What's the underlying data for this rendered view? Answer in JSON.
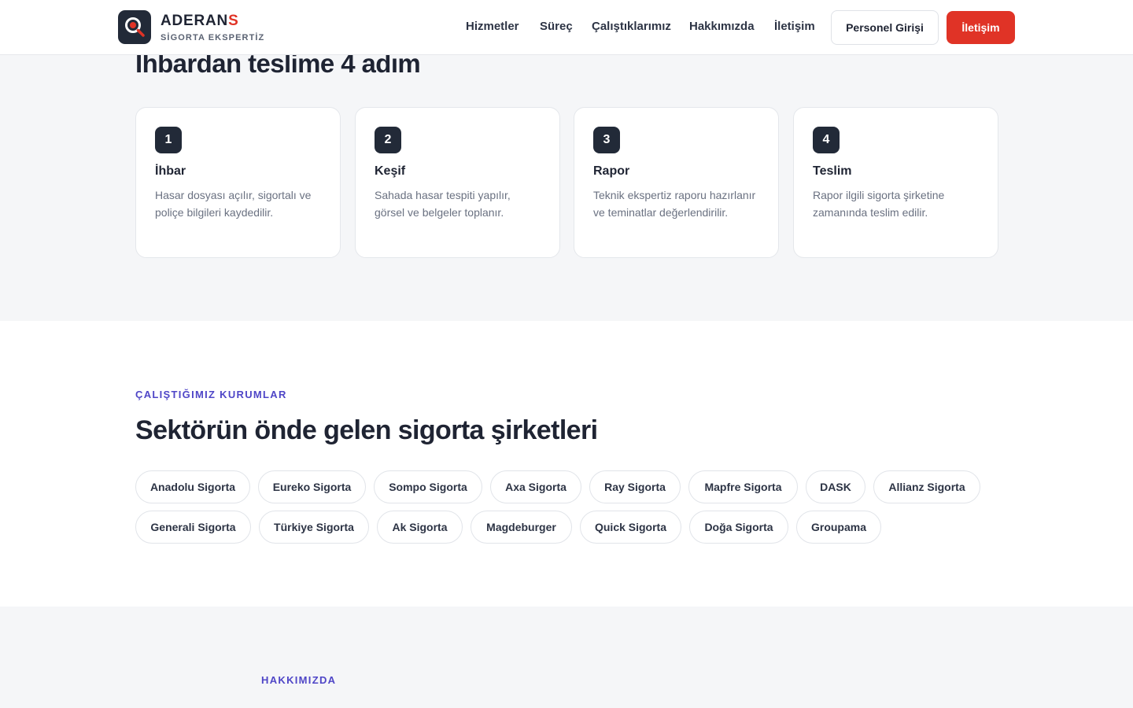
{
  "brand": {
    "name_main": "ADERAN",
    "name_accent": "S",
    "tagline": "SİGORTA EKSPERTİZ",
    "accent_color": "#e03326",
    "dark_color": "#222a38"
  },
  "nav": {
    "links": [
      "Hizmetler",
      "Süreç",
      "Çalıştıklarımız",
      "Hakkımızda",
      "İletişim"
    ],
    "login_label": "Personel Girişi",
    "cta_label": "İletişim"
  },
  "process": {
    "title": "İhbardan teslime 4 adım",
    "steps": [
      {
        "num": "1",
        "title": "İhbar",
        "desc": "Hasar dosyası açılır, sigortalı ve poliçe bilgileri kaydedilir."
      },
      {
        "num": "2",
        "title": "Keşif",
        "desc": "Sahada hasar tespiti yapılır, görsel ve belgeler toplanır."
      },
      {
        "num": "3",
        "title": "Rapor",
        "desc": "Teknik ekspertiz raporu hazırlanır ve teminatlar değerlendirilir."
      },
      {
        "num": "4",
        "title": "Teslim",
        "desc": "Rapor ilgili sigorta şirketine zamanında teslim edilir."
      }
    ]
  },
  "partners": {
    "eyebrow": "ÇALIŞTIĞIMIZ KURUMLAR",
    "title": "Sektörün önde gelen sigorta şirketleri",
    "companies": [
      "Anadolu Sigorta",
      "Eureko Sigorta",
      "Sompo Sigorta",
      "Axa Sigorta",
      "Ray Sigorta",
      "Mapfre Sigorta",
      "DASK",
      "Allianz Sigorta",
      "Generali Sigorta",
      "Türkiye Sigorta",
      "Ak Sigorta",
      "Magdeburger",
      "Quick Sigorta",
      "Doğa Sigorta",
      "Groupama"
    ]
  },
  "about": {
    "eyebrow": "HAKKIMIZDA",
    "title": ""
  }
}
